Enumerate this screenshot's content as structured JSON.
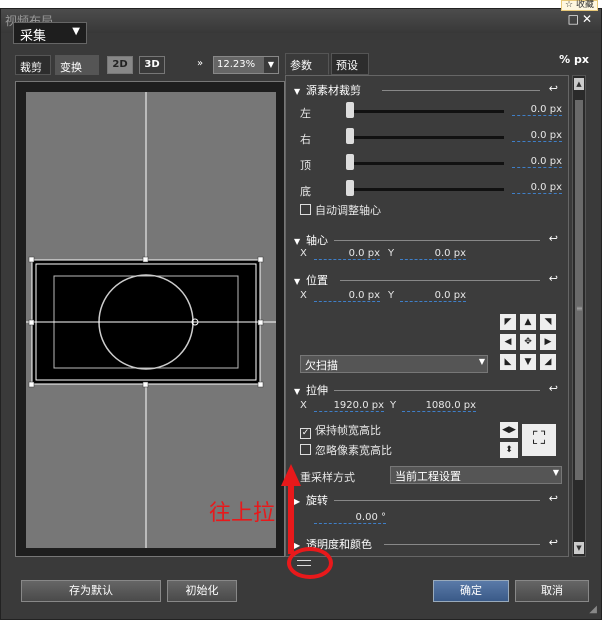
{
  "top": {
    "favorite": "收藏"
  },
  "window": {
    "title": "视频布局",
    "capture_label": "采集"
  },
  "left": {
    "tabs": [
      "裁剪",
      "变换"
    ],
    "mode_2d": "2D",
    "mode_3d": "3D",
    "zoom": "12.23%"
  },
  "right": {
    "tabs": [
      "参数",
      "预设"
    ],
    "unit_pct": "%",
    "unit_px": "px"
  },
  "sections": {
    "crop": {
      "title": "源素材裁剪",
      "rows": [
        {
          "label": "左",
          "value": "0.0 px"
        },
        {
          "label": "右",
          "value": "0.0 px"
        },
        {
          "label": "顶",
          "value": "0.0 px"
        },
        {
          "label": "底",
          "value": "0.0 px"
        }
      ],
      "auto_center": "自动调整轴心"
    },
    "axis": {
      "title": "轴心",
      "x_label": "X",
      "x": "0.0 px",
      "y_label": "Y",
      "y": "0.0 px"
    },
    "position": {
      "title": "位置",
      "x_label": "X",
      "x": "0.0 px",
      "y_label": "Y",
      "y": "0.0 px",
      "scan": "欠扫描"
    },
    "stretch": {
      "title": "拉伸",
      "x_label": "X",
      "x": "1920.0 px",
      "y_label": "Y",
      "y": "1080.0 px",
      "keep_aspect": "保持帧宽高比",
      "ignore_pixel": "忽略像素宽高比",
      "resample_label": "重采样方式",
      "resample_value": "当前工程设置"
    },
    "rotate": {
      "title": "旋转",
      "value": "0.00 °"
    },
    "opacity": {
      "title": "透明度和颜色"
    }
  },
  "annotation": {
    "text": "往上拉"
  },
  "footer": {
    "save_default": "存为默认",
    "initialize": "初始化",
    "ok": "确定",
    "cancel": "取消"
  }
}
